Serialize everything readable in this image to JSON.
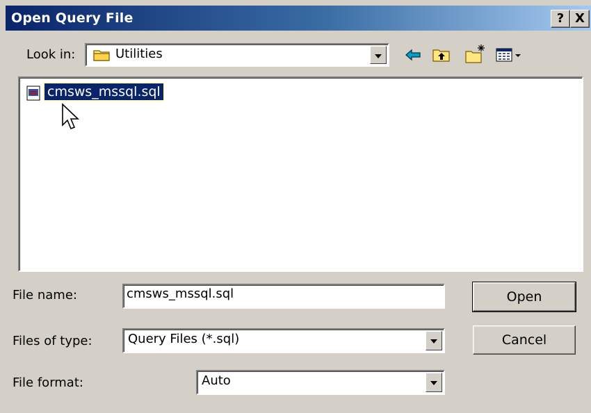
{
  "window": {
    "title": "Open Query File"
  },
  "titlebar_buttons": {
    "help": "?",
    "close": "X"
  },
  "lookin": {
    "label": "Look in:",
    "value": "Utilities"
  },
  "files": [
    {
      "name": "cmsws_mssql.sql",
      "selected": true
    }
  ],
  "filename": {
    "label": "File name:",
    "value": "cmsws_mssql.sql"
  },
  "filetype": {
    "label": "Files of type:",
    "value": "Query Files (*.sql)"
  },
  "fileformat": {
    "label": "File format:",
    "value": "Auto"
  },
  "buttons": {
    "open": "Open",
    "cancel": "Cancel"
  },
  "icons": {
    "back": "back-arrow-icon",
    "up": "up-folder-icon",
    "new_folder": "new-folder-icon",
    "views": "views-menu-icon"
  },
  "colors": {
    "titlebar_start": "#0a246a",
    "titlebar_end": "#a6caf0",
    "selection": "#0a246a",
    "face": "#d4d0c8"
  }
}
